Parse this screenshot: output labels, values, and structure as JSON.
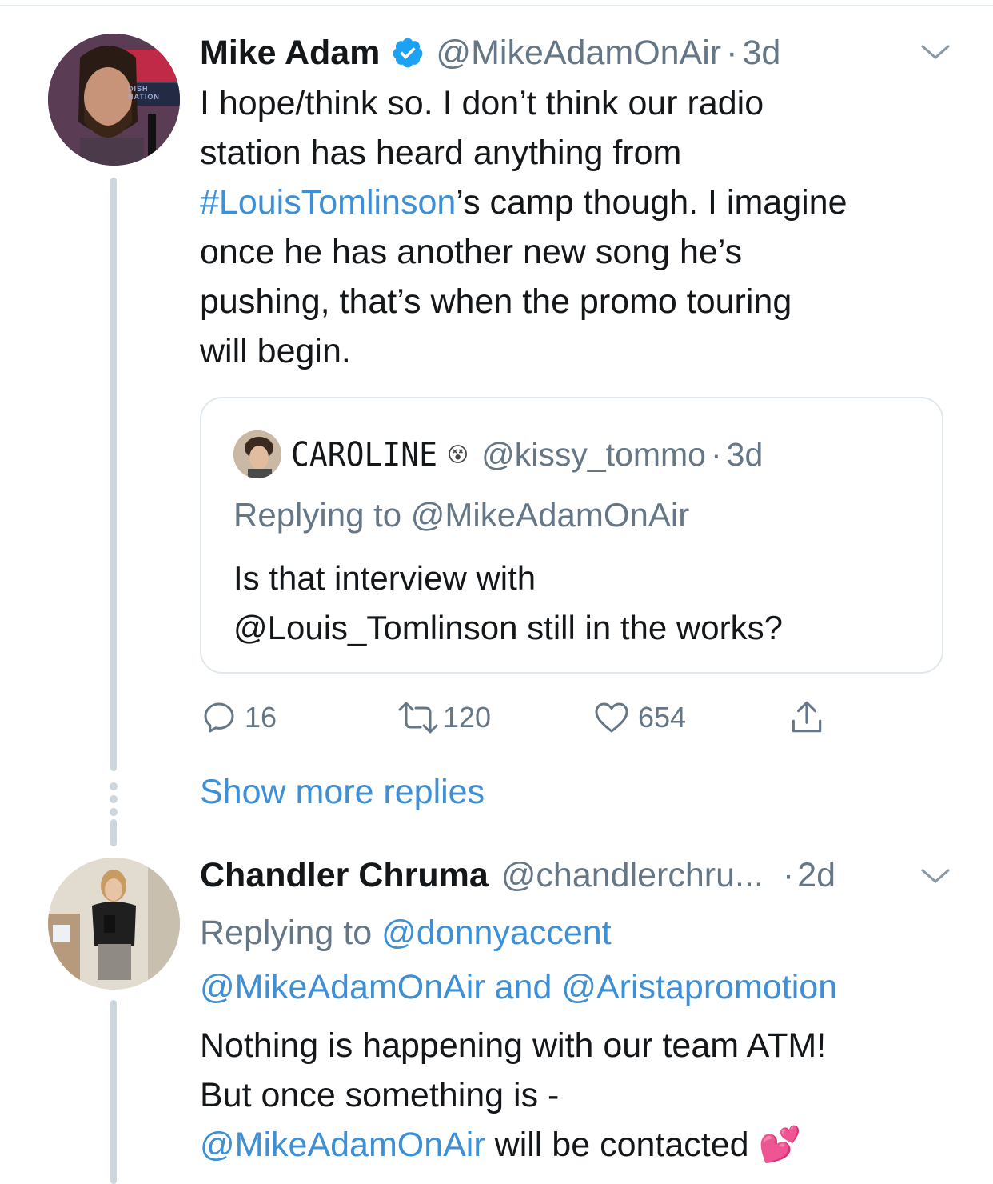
{
  "tweet1": {
    "author_name": "Mike Adam",
    "handle": "@MikeAdamOnAir",
    "separator": "·",
    "time": "3d",
    "body_line1": "I hope/think so. I don’t think our radio",
    "body_line2": "station has heard anything from",
    "body_hashtag": "#LouisTomlinson",
    "body_line3_rest": "’s camp though. I imagine",
    "body_line4": "once he has another new song he’s",
    "body_line5": "pushing, that’s when the promo touring",
    "body_line6": "will begin.",
    "verified_icon": "verified-badge-icon",
    "avatar_sign_text": "DISH NATION",
    "quoted": {
      "author_name": "CAROLINE",
      "emoji": "😵",
      "handle": "@kissy_tommo",
      "separator": "·",
      "time": "3d",
      "replying_prefix": "Replying to",
      "replying_handle": "@MikeAdamOnAir",
      "body_line1": "Is that interview with",
      "body_line2": "@Louis_Tomlinson still in the works?"
    },
    "actions": {
      "reply_count": "16",
      "retweet_count": "120",
      "like_count": "654"
    }
  },
  "show_more_replies": "Show more replies",
  "tweet2": {
    "author_name": "Chandler Chruma",
    "handle": "@chandlerchru...",
    "separator": "·",
    "time": "2d",
    "replying_prefix": "Replying to",
    "replying_handle1": "@donnyaccent",
    "replying_handle2": "@MikeAdamOnAir",
    "replying_and": "and",
    "replying_handle3": "@Aristapromotion",
    "body_line1": "Nothing is happening with our team ATM!",
    "body_line2": "But once something is -",
    "body_mention": "@MikeAdamOnAir",
    "body_line3_rest": " will be contacted",
    "emoji": "💕"
  },
  "colors": {
    "link": "#3d8fd6",
    "muted": "#657786",
    "thread_line": "#ccd6dd",
    "verified": "#1da1f2"
  }
}
